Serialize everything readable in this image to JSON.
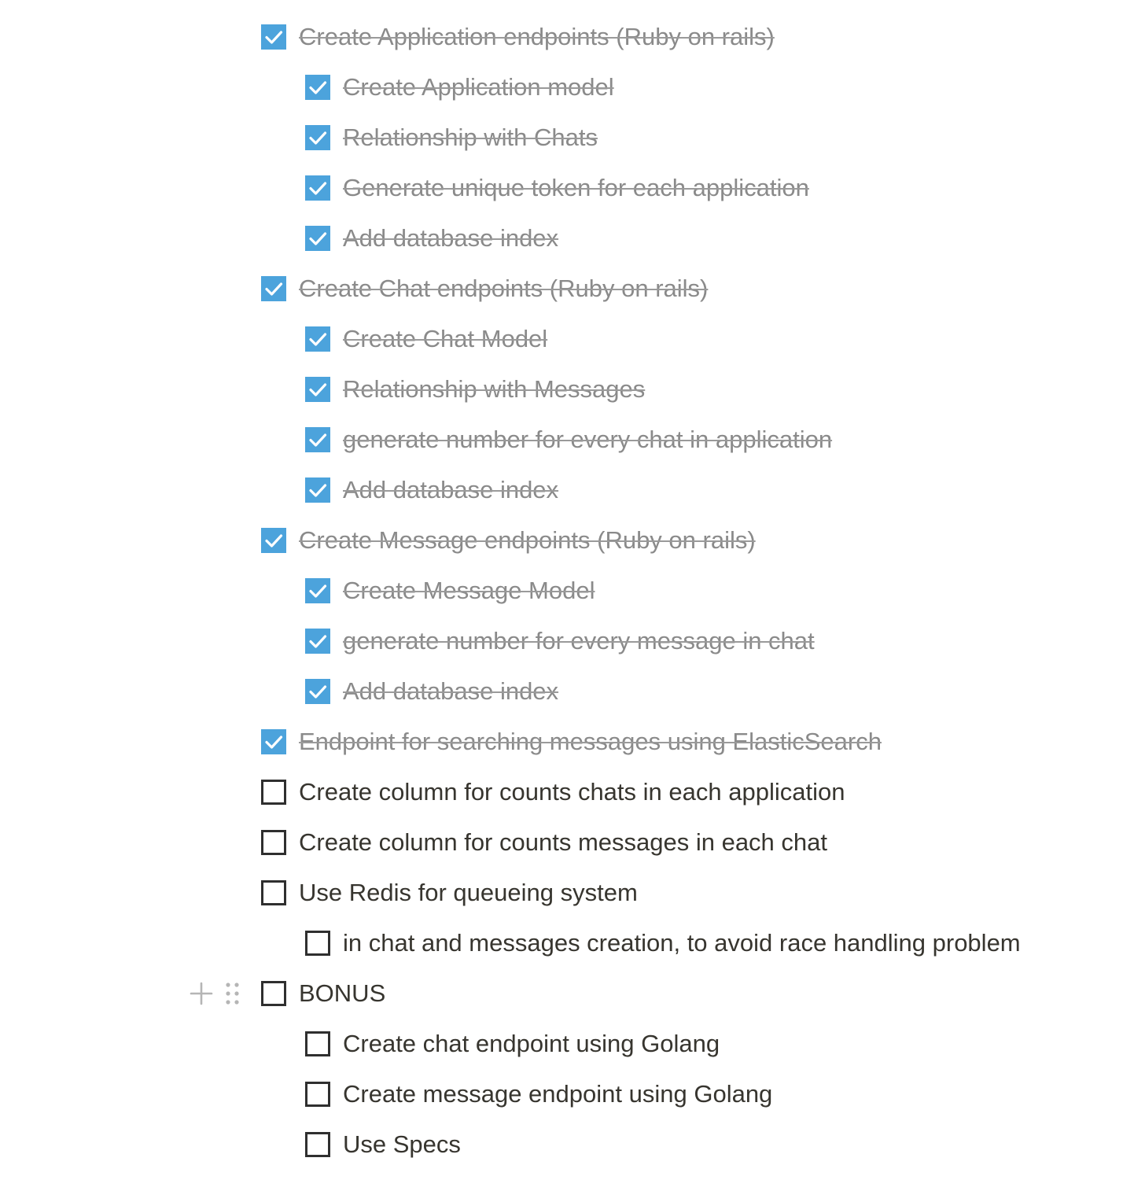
{
  "colors": {
    "checkbox_checked": "#4ca3dc",
    "text_done": "#8a8a8a",
    "text_open": "#37352f"
  },
  "icons": {
    "checkmark": "check-icon",
    "add_block": "plus-icon",
    "drag_handle": "drag-handle-icon"
  },
  "todos": [
    {
      "text": "Create Application endpoints (Ruby on rails)",
      "checked": true,
      "level": 0
    },
    {
      "text": "Create Application model",
      "checked": true,
      "level": 1
    },
    {
      "text": "Relationship with Chats",
      "checked": true,
      "level": 1
    },
    {
      "text": "Generate unique token for each application",
      "checked": true,
      "level": 1
    },
    {
      "text": "Add database index",
      "checked": true,
      "level": 1
    },
    {
      "text": "Create Chat endpoints (Ruby on rails)",
      "checked": true,
      "level": 0
    },
    {
      "text": "Create Chat Model",
      "checked": true,
      "level": 1
    },
    {
      "text": "Relationship with Messages",
      "checked": true,
      "level": 1
    },
    {
      "text": "generate number for every chat in application",
      "checked": true,
      "level": 1
    },
    {
      "text": "Add database index",
      "checked": true,
      "level": 1
    },
    {
      "text": "Create Message endpoints (Ruby on rails)",
      "checked": true,
      "level": 0
    },
    {
      "text": "Create Message Model",
      "checked": true,
      "level": 1
    },
    {
      "text": "generate number for every message in chat",
      "checked": true,
      "level": 1
    },
    {
      "text": "Add database index",
      "checked": true,
      "level": 1
    },
    {
      "text": "Endpoint for searching messages using ElasticSearch",
      "checked": true,
      "level": 0
    },
    {
      "text": "Create column for counts chats in each application",
      "checked": false,
      "level": 0
    },
    {
      "text": "Create column for counts messages in each chat",
      "checked": false,
      "level": 0
    },
    {
      "text": "Use Redis for queueing system",
      "checked": false,
      "level": 0
    },
    {
      "text": "in chat and messages creation, to avoid race handling problem",
      "checked": false,
      "level": 1
    },
    {
      "text": "BONUS",
      "checked": false,
      "level": 0,
      "hovered": true
    },
    {
      "text": "Create chat endpoint using Golang",
      "checked": false,
      "level": 1
    },
    {
      "text": "Create message endpoint using Golang",
      "checked": false,
      "level": 1
    },
    {
      "text": "Use Specs",
      "checked": false,
      "level": 1
    }
  ]
}
